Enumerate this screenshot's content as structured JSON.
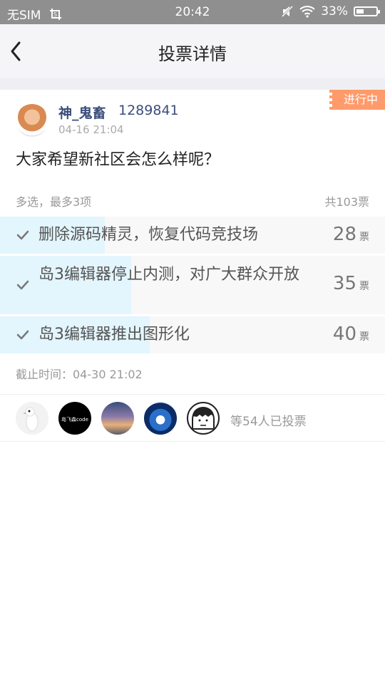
{
  "status_bar": {
    "carrier": "无SIM",
    "time": "20:42",
    "battery": "33%"
  },
  "header": {
    "title": "投票详情"
  },
  "post": {
    "status_badge": "进行中",
    "username": "神_鬼畜",
    "user_id": "1289841",
    "date": "04-16 21:04",
    "question": "大家希望新社区会怎么样呢？",
    "mode": "多选，最多3项",
    "total": "共103票",
    "deadline": "截止时间：04-30 21:02"
  },
  "options": [
    {
      "label": "删除源码精灵，恢复代码竞技场",
      "votes": "28",
      "unit": "票",
      "fraction": 0.272
    },
    {
      "label": "岛3编辑器停止内测，对广大群众开放",
      "votes": "35",
      "unit": "票",
      "fraction": 0.34
    },
    {
      "label": "岛3编辑器推出图形化",
      "votes": "40",
      "unit": "票",
      "fraction": 0.388
    }
  ],
  "voters": {
    "summary": "等54人已投票",
    "avatar2_text": "岛飞森code"
  },
  "colors": {
    "badge": "#ff9a6a",
    "bar_fill": "#e3f5fd",
    "username": "#3a4d7a"
  }
}
